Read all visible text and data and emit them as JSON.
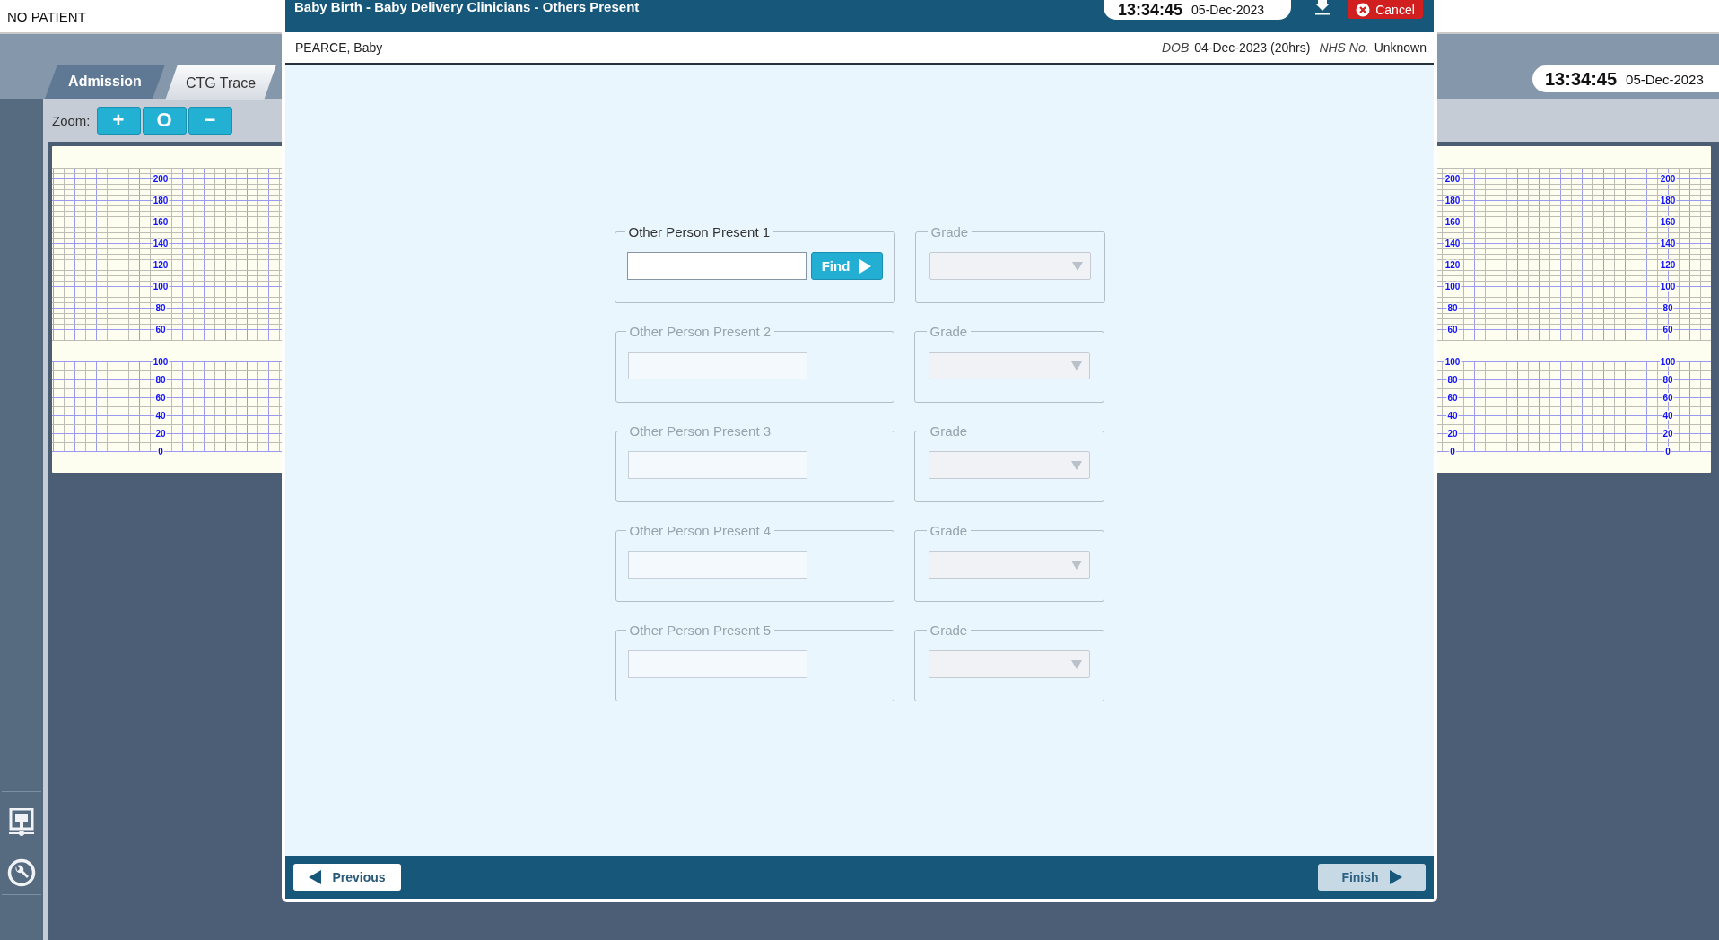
{
  "app": {
    "patient_banner": "NO PATIENT",
    "tabs": [
      {
        "label": "Admission",
        "selected": false
      },
      {
        "label": "CTG Trace",
        "selected": true
      }
    ],
    "clock": {
      "time": "13:34:45",
      "date": "05-Dec-2023"
    },
    "zoom": {
      "label": "Zoom:",
      "buttons": [
        "+",
        "O",
        "−"
      ]
    }
  },
  "ctg": {
    "scales": [
      {
        "fhr": [
          "200",
          "180",
          "160",
          "140",
          "120",
          "100",
          "80",
          "60"
        ],
        "toco": [
          "100",
          "80",
          "60",
          "40",
          "20",
          "0"
        ]
      },
      {
        "fhr": [
          "200",
          "180",
          "160",
          "140",
          "120",
          "100",
          "80",
          "60"
        ],
        "toco": [
          "100",
          "80",
          "60",
          "40",
          "20",
          "0"
        ]
      },
      {
        "fhr": [
          "200",
          "180",
          "160",
          "140",
          "120",
          "100",
          "80",
          "60"
        ],
        "toco": [
          "100",
          "80",
          "60",
          "40",
          "20",
          "0"
        ]
      }
    ]
  },
  "dialog": {
    "title": "Baby Birth - Baby Delivery Clinicians - Others Present",
    "clock": {
      "time": "13:34:45",
      "date": "05-Dec-2023"
    },
    "cancel": "Cancel",
    "patient": {
      "name": "PEARCE, Baby",
      "dob_label": "DOB",
      "dob": "04-Dec-2023 (20hrs)",
      "nhs_label": "NHS No.",
      "nhs": "Unknown"
    },
    "people": [
      {
        "legend": "Other Person Present 1",
        "disabled": false,
        "find_button": "Find",
        "grade": {
          "legend": "Grade",
          "disabled": true
        }
      },
      {
        "legend": "Other Person Present 2",
        "disabled": true,
        "grade": {
          "legend": "Grade",
          "disabled": true
        }
      },
      {
        "legend": "Other Person Present 3",
        "disabled": true,
        "grade": {
          "legend": "Grade",
          "disabled": true
        }
      },
      {
        "legend": "Other Person Present 4",
        "disabled": true,
        "grade": {
          "legend": "Grade",
          "disabled": true
        }
      },
      {
        "legend": "Other Person Present 5",
        "disabled": true,
        "grade": {
          "legend": "Grade",
          "disabled": true
        }
      }
    ],
    "footer": {
      "previous": {
        "label": "Previous",
        "disabled": false
      },
      "finish": {
        "label": "Finish",
        "disabled": true
      }
    }
  }
}
